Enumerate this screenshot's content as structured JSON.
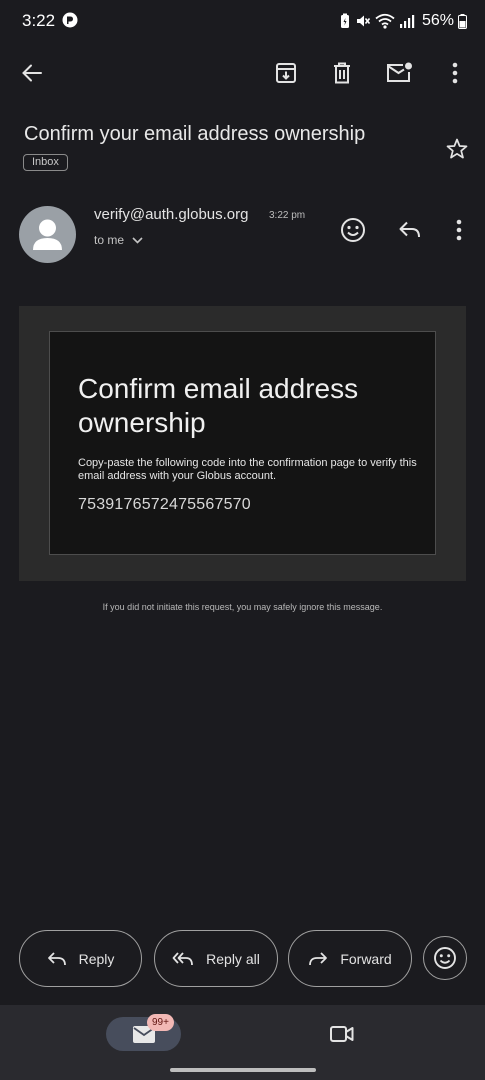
{
  "status_bar": {
    "time": "3:22",
    "battery": "56%"
  },
  "toolbar": {
    "icons": [
      "back-arrow-icon",
      "archive-icon",
      "delete-icon",
      "mark-unread-icon",
      "more-vert-icon"
    ]
  },
  "email": {
    "subject": "Confirm your email address ownership",
    "label": "Inbox",
    "sender": "verify@auth.globus.org",
    "time": "3:22 pm",
    "recipient": "to me",
    "body": {
      "heading": "Confirm email address ownership",
      "description": "Copy-paste the following code into the confirmation page to verify this email address with your Globus account.",
      "code": "7539176572475567570"
    },
    "footer": "If you did not initiate this request, you may safely ignore this message."
  },
  "actions": {
    "reply": "Reply",
    "reply_all": "Reply all",
    "forward": "Forward"
  },
  "bottom_nav": {
    "mail_badge": "99+"
  },
  "colors": {
    "background": "#1b1b1f",
    "nav_background": "#2a2a2f",
    "active_pill": "#474d5c",
    "badge": "#f2b8b5"
  }
}
